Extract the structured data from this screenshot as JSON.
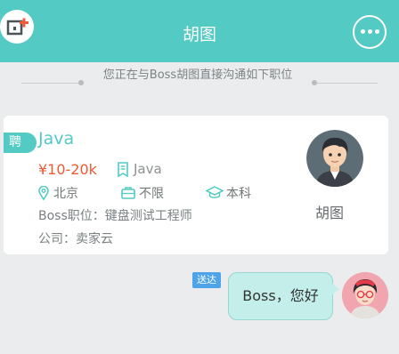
{
  "header": {
    "title": "胡图",
    "back_icon": "chat-add-icon",
    "more_icon": "more-icon"
  },
  "notice": {
    "text": "您正在与Boss胡图直接沟通如下职位"
  },
  "job_card": {
    "tag": "聘",
    "title": "Java",
    "salary": "¥10-20k",
    "skill": "Java",
    "location": "北京",
    "experience": "不限",
    "education": "本科",
    "boss_position": "Boss职位：键盘测试工程师",
    "company": "公司：卖家云",
    "boss_name": "胡图"
  },
  "chat": {
    "status": "送达",
    "message": "Boss，您好"
  },
  "colors": {
    "accent": "#53cac3",
    "salary": "#ef5a35",
    "status": "#4fa3e8"
  }
}
